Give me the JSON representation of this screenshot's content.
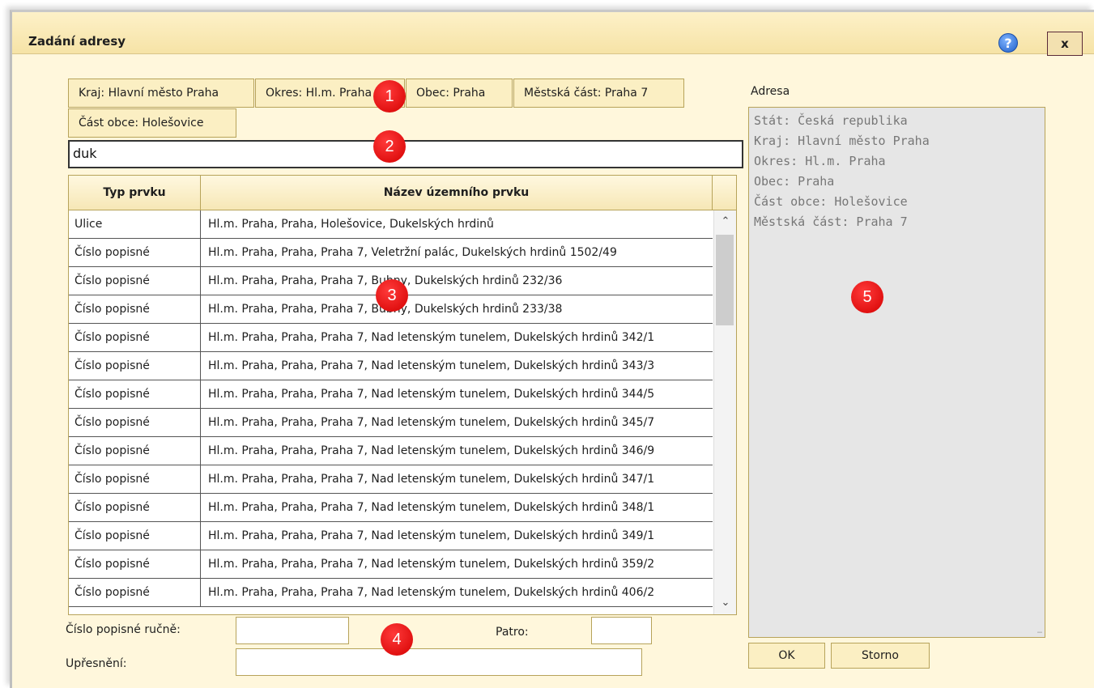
{
  "dialog": {
    "title": "Zadání adresy",
    "help_icon": "help-icon",
    "close_label": "x"
  },
  "filters": {
    "kraj": "Kraj: Hlavní město Praha",
    "okres": "Okres: Hl.m. Praha",
    "obec": "Obec: Praha",
    "mestska_cast": "Městská část: Praha 7",
    "cast_obce": "Část obce: Holešovice"
  },
  "search": {
    "value": "duk"
  },
  "grid": {
    "headers": [
      "Typ prvku",
      "Název územního prvku"
    ],
    "rows": [
      [
        "Ulice",
        "Hl.m. Praha, Praha, Holešovice, Dukelských hrdinů"
      ],
      [
        "Číslo popisné",
        "Hl.m. Praha, Praha, Praha 7, Veletržní palác, Dukelských hrdinů 1502/49"
      ],
      [
        "Číslo popisné",
        "Hl.m. Praha, Praha, Praha 7, Bubny, Dukelských hrdinů 232/36"
      ],
      [
        "Číslo popisné",
        "Hl.m. Praha, Praha, Praha 7, Bubny, Dukelských hrdinů 233/38"
      ],
      [
        "Číslo popisné",
        "Hl.m. Praha, Praha, Praha 7, Nad letenským tunelem, Dukelských hrdinů 342/1"
      ],
      [
        "Číslo popisné",
        "Hl.m. Praha, Praha, Praha 7, Nad letenským tunelem, Dukelských hrdinů 343/3"
      ],
      [
        "Číslo popisné",
        "Hl.m. Praha, Praha, Praha 7, Nad letenským tunelem, Dukelských hrdinů 344/5"
      ],
      [
        "Číslo popisné",
        "Hl.m. Praha, Praha, Praha 7, Nad letenským tunelem, Dukelských hrdinů 345/7"
      ],
      [
        "Číslo popisné",
        "Hl.m. Praha, Praha, Praha 7, Nad letenským tunelem, Dukelských hrdinů 346/9"
      ],
      [
        "Číslo popisné",
        "Hl.m. Praha, Praha, Praha 7, Nad letenským tunelem, Dukelských hrdinů 347/1"
      ],
      [
        "Číslo popisné",
        "Hl.m. Praha, Praha, Praha 7, Nad letenským tunelem, Dukelských hrdinů 348/1"
      ],
      [
        "Číslo popisné",
        "Hl.m. Praha, Praha, Praha 7, Nad letenským tunelem, Dukelských hrdinů 349/1"
      ],
      [
        "Číslo popisné",
        "Hl.m. Praha, Praha, Praha 7, Nad letenským tunelem, Dukelských hrdinů 359/2"
      ],
      [
        "Číslo popisné",
        "Hl.m. Praha, Praha, Praha 7, Nad letenským tunelem, Dukelských hrdinů 406/2"
      ]
    ]
  },
  "manual": {
    "cislo_label": "Číslo popisné ručně:",
    "patro_label": "Patro:",
    "upresneni_label": "Upřesnění:"
  },
  "address": {
    "label": "Adresa",
    "lines": [
      "Stát: Česká republika",
      "Kraj: Hlavní město Praha",
      "Okres: Hl.m. Praha",
      "Obec: Praha",
      "Část obce: Holešovice",
      "Městská část: Praha 7"
    ]
  },
  "buttons": {
    "ok": "OK",
    "cancel": "Storno"
  },
  "markers": [
    "1",
    "2",
    "3",
    "4",
    "5"
  ],
  "colors": {
    "panel": "#fff7dc",
    "accent_border": "#b7a35a",
    "marker": "#e00000"
  }
}
